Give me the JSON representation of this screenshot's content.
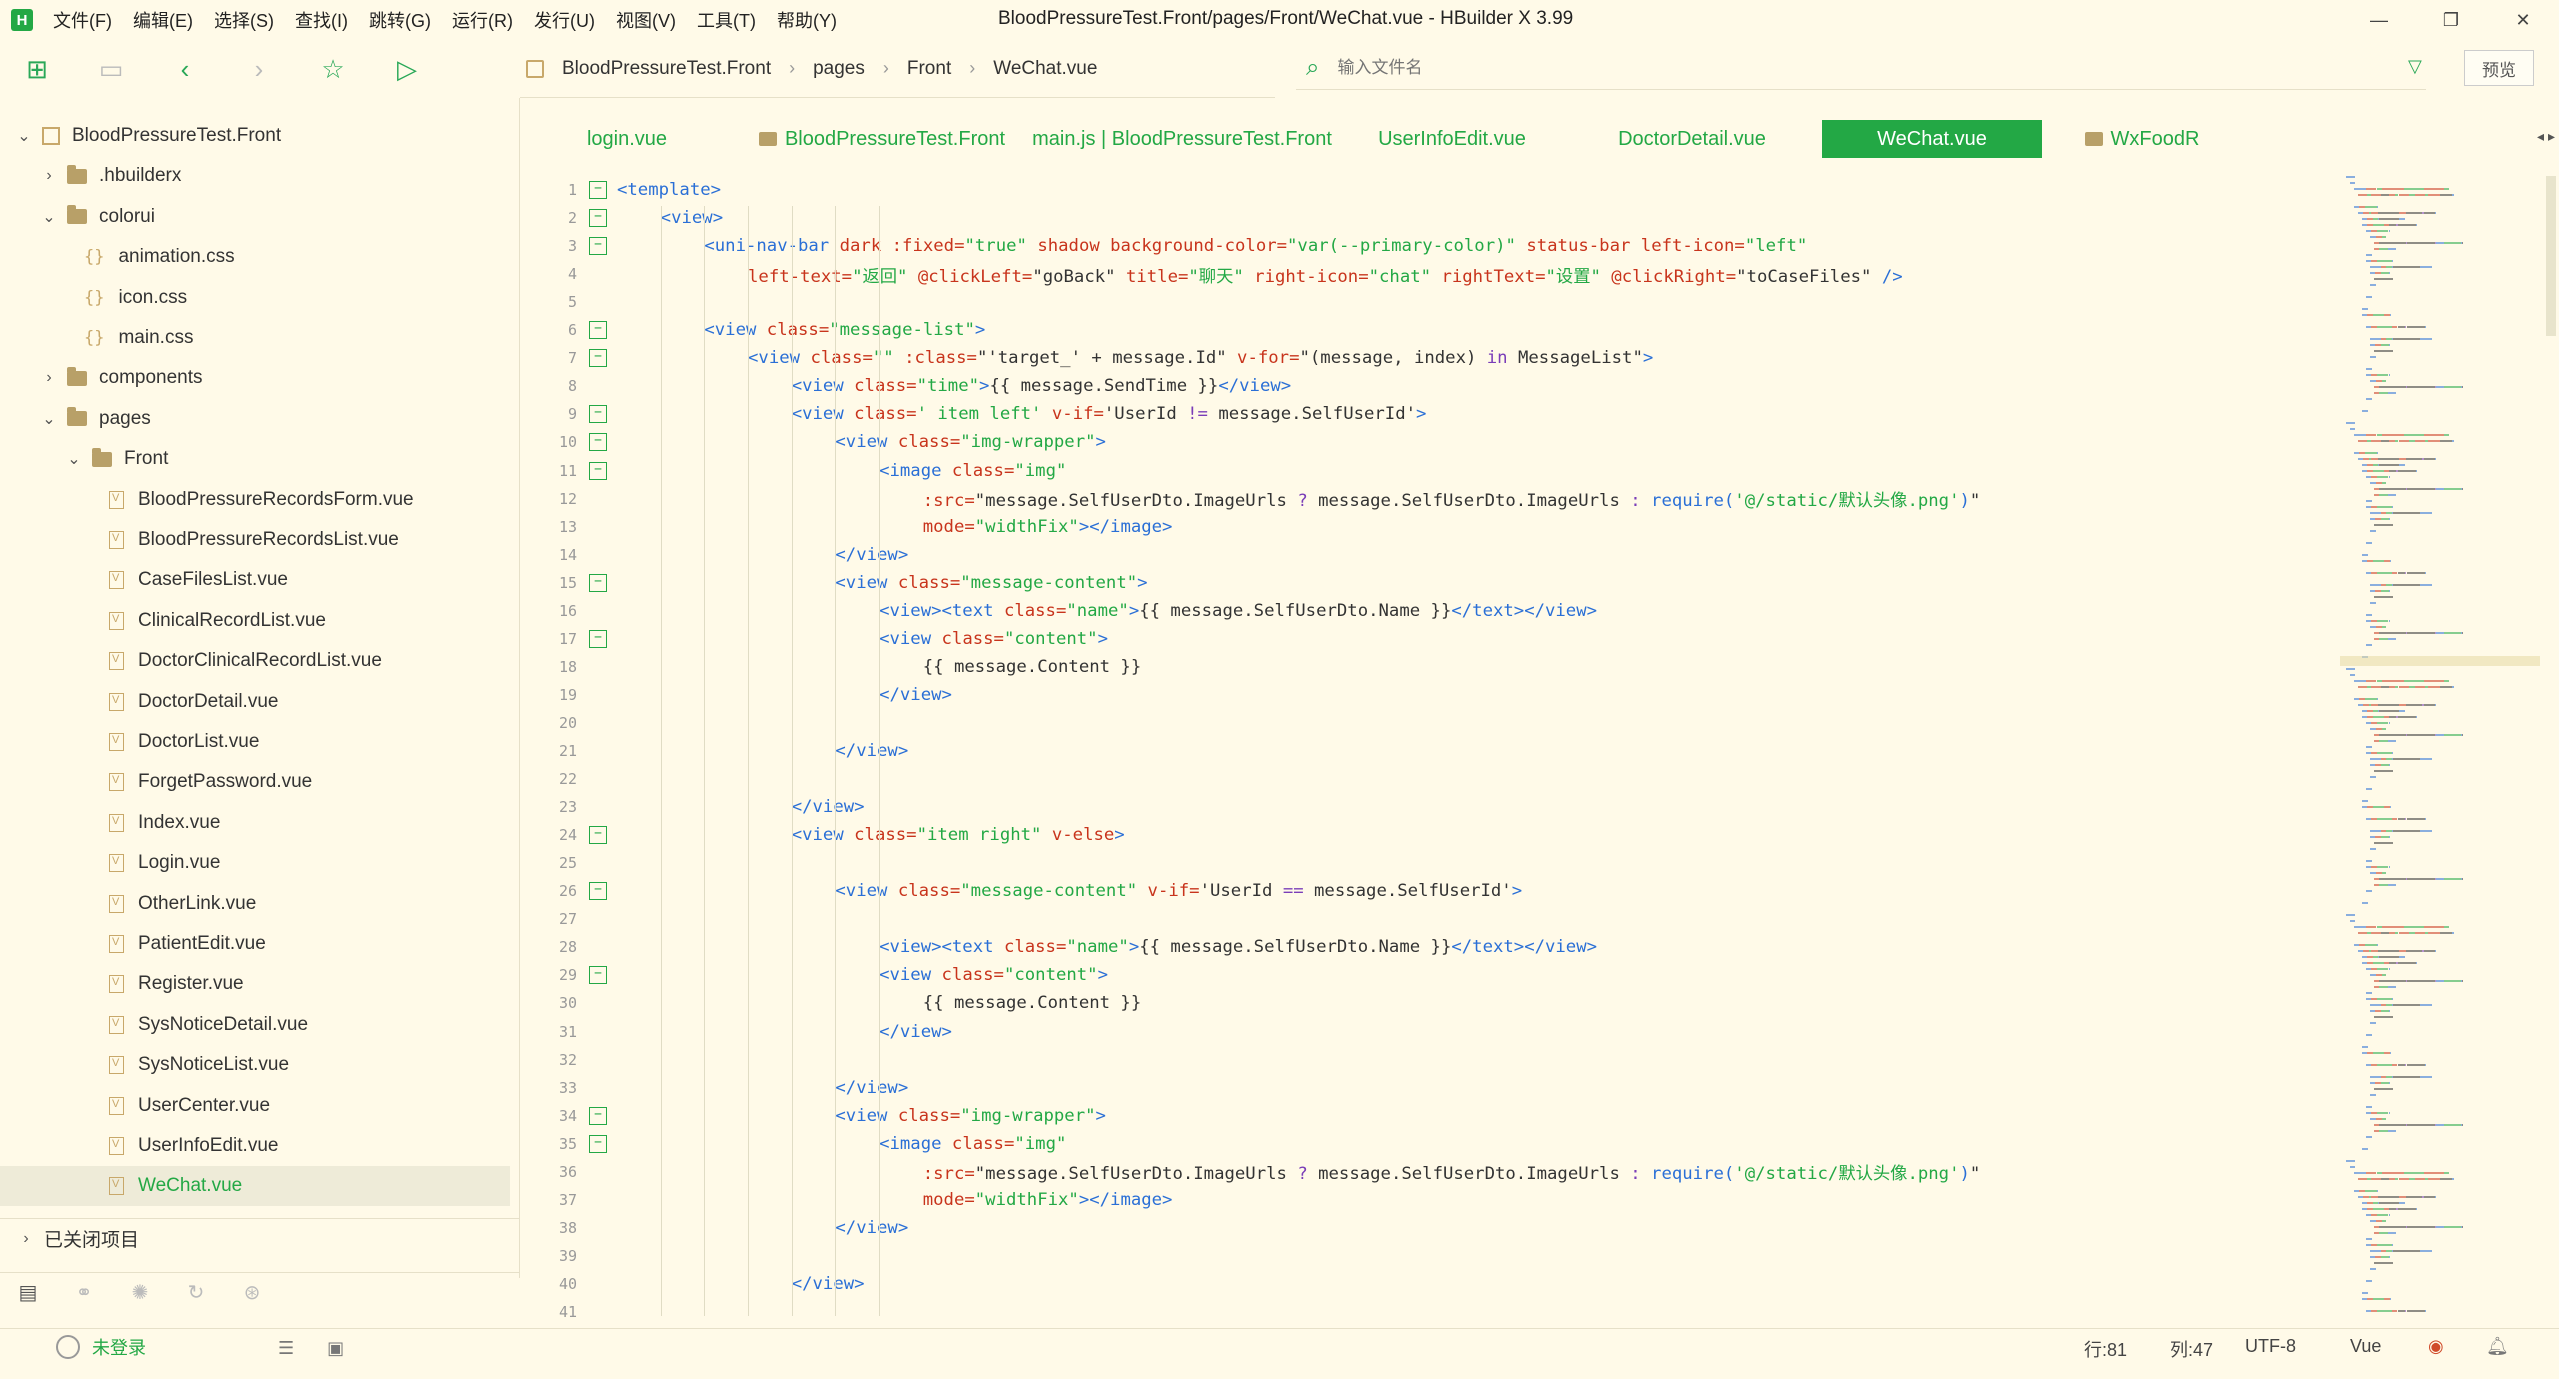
{
  "titlebar": {
    "menu": [
      "文件(F)",
      "编辑(E)",
      "选择(S)",
      "查找(I)",
      "跳转(G)",
      "运行(R)",
      "发行(U)",
      "视图(V)",
      "工具(T)",
      "帮助(Y)"
    ],
    "window_title": "BloodPressureTest.Front/pages/Front/WeChat.vue - HBuilder X 3.99"
  },
  "breadcrumb": [
    "BloodPressureTest.Front",
    "pages",
    "Front",
    "WeChat.vue"
  ],
  "file_search": {
    "placeholder": "输入文件名"
  },
  "preview_label": "预览",
  "tree": [
    {
      "label": "BloodPressureTest.Front",
      "type": "project",
      "level": 0,
      "chev": "v"
    },
    {
      "label": ".hbuilderx",
      "type": "folder",
      "level": 1,
      "chev": ">"
    },
    {
      "label": "colorui",
      "type": "folder",
      "level": 1,
      "chev": "v"
    },
    {
      "label": "animation.css",
      "type": "css",
      "level": 2
    },
    {
      "label": "icon.css",
      "type": "css",
      "level": 2
    },
    {
      "label": "main.css",
      "type": "css",
      "level": 2
    },
    {
      "label": "components",
      "type": "folder",
      "level": 1,
      "chev": ">"
    },
    {
      "label": "pages",
      "type": "folder",
      "level": 1,
      "chev": "v"
    },
    {
      "label": "Front",
      "type": "folder",
      "level": 2,
      "chev": "v"
    },
    {
      "label": "BloodPressureRecordsForm.vue",
      "type": "vue",
      "level": 3
    },
    {
      "label": "BloodPressureRecordsList.vue",
      "type": "vue",
      "level": 3
    },
    {
      "label": "CaseFilesList.vue",
      "type": "vue",
      "level": 3
    },
    {
      "label": "ClinicalRecordList.vue",
      "type": "vue",
      "level": 3
    },
    {
      "label": "DoctorClinicalRecordList.vue",
      "type": "vue",
      "level": 3
    },
    {
      "label": "DoctorDetail.vue",
      "type": "vue",
      "level": 3
    },
    {
      "label": "DoctorList.vue",
      "type": "vue",
      "level": 3
    },
    {
      "label": "ForgetPassword.vue",
      "type": "vue",
      "level": 3
    },
    {
      "label": "Index.vue",
      "type": "vue",
      "level": 3
    },
    {
      "label": "Login.vue",
      "type": "vue",
      "level": 3
    },
    {
      "label": "OtherLink.vue",
      "type": "vue",
      "level": 3
    },
    {
      "label": "PatientEdit.vue",
      "type": "vue",
      "level": 3
    },
    {
      "label": "Register.vue",
      "type": "vue",
      "level": 3
    },
    {
      "label": "SysNoticeDetail.vue",
      "type": "vue",
      "level": 3
    },
    {
      "label": "SysNoticeList.vue",
      "type": "vue",
      "level": 3
    },
    {
      "label": "UserCenter.vue",
      "type": "vue",
      "level": 3
    },
    {
      "label": "UserInfoEdit.vue",
      "type": "vue",
      "level": 3
    },
    {
      "label": "WeChat.vue",
      "type": "vue",
      "level": 3,
      "selected": true
    }
  ],
  "closed_projects_label": "已关闭项目",
  "tabs": [
    {
      "label": "login.vue",
      "folder": false,
      "active": false
    },
    {
      "label": "BloodPressureTest.Front",
      "folder": true,
      "active": false
    },
    {
      "label": "main.js | BloodPressureTest.Front",
      "folder": false,
      "active": false
    },
    {
      "label": "UserInfoEdit.vue",
      "folder": false,
      "active": false
    },
    {
      "label": "DoctorDetail.vue",
      "folder": false,
      "active": false
    },
    {
      "label": "WeChat.vue",
      "folder": false,
      "active": true
    },
    {
      "label": "WxFoodR",
      "folder": true,
      "active": false
    }
  ],
  "colors": {
    "accent": "#23a845",
    "tag": "#2a6fd6",
    "attr": "#c8341c",
    "string": "#23a845",
    "keyword": "#7a3db8",
    "text": "#333333",
    "background": "#fffae8"
  },
  "code_lines": [
    {
      "n": "1",
      "fold": true,
      "indent": 0,
      "tokens": [
        [
          "tag",
          "<template>"
        ]
      ]
    },
    {
      "n": "2",
      "fold": true,
      "indent": 1,
      "tokens": [
        [
          "tag",
          "<view>"
        ]
      ]
    },
    {
      "n": "3",
      "fold": true,
      "indent": 2,
      "tokens": [
        [
          "tag",
          "<uni-nav-bar "
        ],
        [
          "attr",
          "dark :fixed="
        ],
        [
          "str",
          "\"true\""
        ],
        [
          "attr",
          " shadow background-color="
        ],
        [
          "str",
          "\"var(--primary-color)\""
        ],
        [
          "attr",
          " status-bar left-icon="
        ],
        [
          "str",
          "\"left\""
        ]
      ]
    },
    {
      "n": "4",
      "fold": false,
      "indent": 3,
      "tokens": [
        [
          "attr",
          "left-text="
        ],
        [
          "str",
          "\"返回\""
        ],
        [
          "attr",
          " @clickLeft="
        ],
        [
          "txt",
          "\"goBack\""
        ],
        [
          "attr",
          " title="
        ],
        [
          "str",
          "\"聊天\""
        ],
        [
          "attr",
          " right-icon="
        ],
        [
          "str",
          "\"chat\""
        ],
        [
          "attr",
          " rightText="
        ],
        [
          "str",
          "\"设置\""
        ],
        [
          "attr",
          " @clickRight="
        ],
        [
          "txt",
          "\"toCaseFiles\""
        ],
        [
          "tag",
          " />"
        ]
      ]
    },
    {
      "n": "5",
      "fold": false,
      "indent": 0,
      "tokens": []
    },
    {
      "n": "6",
      "fold": true,
      "indent": 2,
      "tokens": [
        [
          "tag",
          "<view "
        ],
        [
          "attr",
          "class="
        ],
        [
          "str",
          "\"message-list\""
        ],
        [
          "tag",
          ">"
        ]
      ]
    },
    {
      "n": "7",
      "fold": true,
      "indent": 3,
      "tokens": [
        [
          "tag",
          "<view "
        ],
        [
          "attr",
          "class="
        ],
        [
          "str",
          "\"\""
        ],
        [
          "attr",
          " :class="
        ],
        [
          "txt",
          "\"'target_' + message.Id\""
        ],
        [
          "attr",
          " v-for="
        ],
        [
          "txt",
          "\"(message, index) "
        ],
        [
          "kw",
          "in"
        ],
        [
          "txt",
          " MessageList\""
        ],
        [
          "tag",
          ">"
        ]
      ]
    },
    {
      "n": "8",
      "fold": false,
      "indent": 4,
      "tokens": [
        [
          "tag",
          "<view "
        ],
        [
          "attr",
          "class="
        ],
        [
          "str",
          "\"time\""
        ],
        [
          "tag",
          ">"
        ],
        [
          "txt",
          "{{ message.SendTime }}"
        ],
        [
          "tag",
          "</view>"
        ]
      ]
    },
    {
      "n": "9",
      "fold": true,
      "indent": 4,
      "tokens": [
        [
          "tag",
          "<view "
        ],
        [
          "attr",
          "class="
        ],
        [
          "str",
          "' item left'"
        ],
        [
          "attr",
          " v-if="
        ],
        [
          "txt",
          "'UserId "
        ],
        [
          "kw",
          "!="
        ],
        [
          "txt",
          " message.SelfUserId'"
        ],
        [
          "tag",
          ">"
        ]
      ]
    },
    {
      "n": "10",
      "fold": true,
      "indent": 5,
      "tokens": [
        [
          "tag",
          "<view "
        ],
        [
          "attr",
          "class="
        ],
        [
          "str",
          "\"img-wrapper\""
        ],
        [
          "tag",
          ">"
        ]
      ]
    },
    {
      "n": "11",
      "fold": true,
      "indent": 6,
      "tokens": [
        [
          "tag",
          "<image "
        ],
        [
          "attr",
          "class="
        ],
        [
          "str",
          "\"img\""
        ]
      ]
    },
    {
      "n": "12",
      "fold": false,
      "indent": 7,
      "tokens": [
        [
          "attr",
          ":src="
        ],
        [
          "txt",
          "\"message.SelfUserDto.ImageUrls "
        ],
        [
          "kw",
          "?"
        ],
        [
          "txt",
          " message.SelfUserDto.ImageUrls "
        ],
        [
          "kw",
          ":"
        ],
        [
          "tag",
          " require("
        ],
        [
          "str",
          "'@/static/默认头像.png'"
        ],
        [
          "tag",
          ")"
        ],
        [
          "txt",
          "\""
        ]
      ]
    },
    {
      "n": "13",
      "fold": false,
      "indent": 7,
      "tokens": [
        [
          "attr",
          "mode="
        ],
        [
          "str",
          "\"widthFix\""
        ],
        [
          "tag",
          "></image>"
        ]
      ]
    },
    {
      "n": "14",
      "fold": false,
      "indent": 5,
      "tokens": [
        [
          "tag",
          "</view>"
        ]
      ]
    },
    {
      "n": "15",
      "fold": true,
      "indent": 5,
      "tokens": [
        [
          "tag",
          "<view "
        ],
        [
          "attr",
          "class="
        ],
        [
          "str",
          "\"message-content\""
        ],
        [
          "tag",
          ">"
        ]
      ]
    },
    {
      "n": "16",
      "fold": false,
      "indent": 6,
      "tokens": [
        [
          "tag",
          "<view><text "
        ],
        [
          "attr",
          "class="
        ],
        [
          "str",
          "\"name\""
        ],
        [
          "tag",
          ">"
        ],
        [
          "txt",
          "{{ message.SelfUserDto.Name }}"
        ],
        [
          "tag",
          "</text></view>"
        ]
      ]
    },
    {
      "n": "17",
      "fold": true,
      "indent": 6,
      "tokens": [
        [
          "tag",
          "<view "
        ],
        [
          "attr",
          "class="
        ],
        [
          "str",
          "\"content\""
        ],
        [
          "tag",
          ">"
        ]
      ]
    },
    {
      "n": "18",
      "fold": false,
      "indent": 7,
      "tokens": [
        [
          "txt",
          "{{ message.Content }}"
        ]
      ]
    },
    {
      "n": "19",
      "fold": false,
      "indent": 6,
      "tokens": [
        [
          "tag",
          "</view>"
        ]
      ]
    },
    {
      "n": "20",
      "fold": false,
      "indent": 0,
      "tokens": []
    },
    {
      "n": "21",
      "fold": false,
      "indent": 5,
      "tokens": [
        [
          "tag",
          "</view>"
        ]
      ]
    },
    {
      "n": "22",
      "fold": false,
      "indent": 0,
      "tokens": []
    },
    {
      "n": "23",
      "fold": false,
      "indent": 4,
      "tokens": [
        [
          "tag",
          "</view>"
        ]
      ]
    },
    {
      "n": "24",
      "fold": true,
      "indent": 4,
      "tokens": [
        [
          "tag",
          "<view "
        ],
        [
          "attr",
          "class="
        ],
        [
          "str",
          "\"item right\""
        ],
        [
          "attr",
          " v-else"
        ],
        [
          "tag",
          ">"
        ]
      ]
    },
    {
      "n": "25",
      "fold": false,
      "indent": 0,
      "tokens": []
    },
    {
      "n": "26",
      "fold": true,
      "indent": 5,
      "tokens": [
        [
          "tag",
          "<view "
        ],
        [
          "attr",
          "class="
        ],
        [
          "str",
          "\"message-content\""
        ],
        [
          "attr",
          " v-if="
        ],
        [
          "txt",
          "'UserId "
        ],
        [
          "kw",
          "=="
        ],
        [
          "txt",
          " message.SelfUserId'"
        ],
        [
          "tag",
          ">"
        ]
      ]
    },
    {
      "n": "27",
      "fold": false,
      "indent": 0,
      "tokens": []
    },
    {
      "n": "28",
      "fold": false,
      "indent": 6,
      "tokens": [
        [
          "tag",
          "<view><text "
        ],
        [
          "attr",
          "class="
        ],
        [
          "str",
          "\"name\""
        ],
        [
          "tag",
          ">"
        ],
        [
          "txt",
          "{{ message.SelfUserDto.Name }}"
        ],
        [
          "tag",
          "</text></view>"
        ]
      ]
    },
    {
      "n": "29",
      "fold": true,
      "indent": 6,
      "tokens": [
        [
          "tag",
          "<view "
        ],
        [
          "attr",
          "class="
        ],
        [
          "str",
          "\"content\""
        ],
        [
          "tag",
          ">"
        ]
      ]
    },
    {
      "n": "30",
      "fold": false,
      "indent": 7,
      "tokens": [
        [
          "txt",
          "{{ message.Content }}"
        ]
      ]
    },
    {
      "n": "31",
      "fold": false,
      "indent": 6,
      "tokens": [
        [
          "tag",
          "</view>"
        ]
      ]
    },
    {
      "n": "32",
      "fold": false,
      "indent": 0,
      "tokens": []
    },
    {
      "n": "33",
      "fold": false,
      "indent": 5,
      "tokens": [
        [
          "tag",
          "</view>"
        ]
      ]
    },
    {
      "n": "34",
      "fold": true,
      "indent": 5,
      "tokens": [
        [
          "tag",
          "<view "
        ],
        [
          "attr",
          "class="
        ],
        [
          "str",
          "\"img-wrapper\""
        ],
        [
          "tag",
          ">"
        ]
      ]
    },
    {
      "n": "35",
      "fold": true,
      "indent": 6,
      "tokens": [
        [
          "tag",
          "<image "
        ],
        [
          "attr",
          "class="
        ],
        [
          "str",
          "\"img\""
        ]
      ]
    },
    {
      "n": "36",
      "fold": false,
      "indent": 7,
      "tokens": [
        [
          "attr",
          ":src="
        ],
        [
          "txt",
          "\"message.SelfUserDto.ImageUrls "
        ],
        [
          "kw",
          "?"
        ],
        [
          "txt",
          " message.SelfUserDto.ImageUrls "
        ],
        [
          "kw",
          ":"
        ],
        [
          "tag",
          " require("
        ],
        [
          "str",
          "'@/static/默认头像.png'"
        ],
        [
          "tag",
          ")"
        ],
        [
          "txt",
          "\""
        ]
      ]
    },
    {
      "n": "37",
      "fold": false,
      "indent": 7,
      "tokens": [
        [
          "attr",
          "mode="
        ],
        [
          "str",
          "\"widthFix\""
        ],
        [
          "tag",
          "></image>"
        ]
      ]
    },
    {
      "n": "38",
      "fold": false,
      "indent": 5,
      "tokens": [
        [
          "tag",
          "</view>"
        ]
      ]
    },
    {
      "n": "39",
      "fold": false,
      "indent": 0,
      "tokens": []
    },
    {
      "n": "40",
      "fold": false,
      "indent": 4,
      "tokens": [
        [
          "tag",
          "</view>"
        ]
      ]
    },
    {
      "n": "41",
      "fold": false,
      "indent": 0,
      "tokens": []
    }
  ],
  "status": {
    "login": "未登录",
    "row": "行:81",
    "col": "列:47",
    "encoding": "UTF-8",
    "language": "Vue"
  }
}
